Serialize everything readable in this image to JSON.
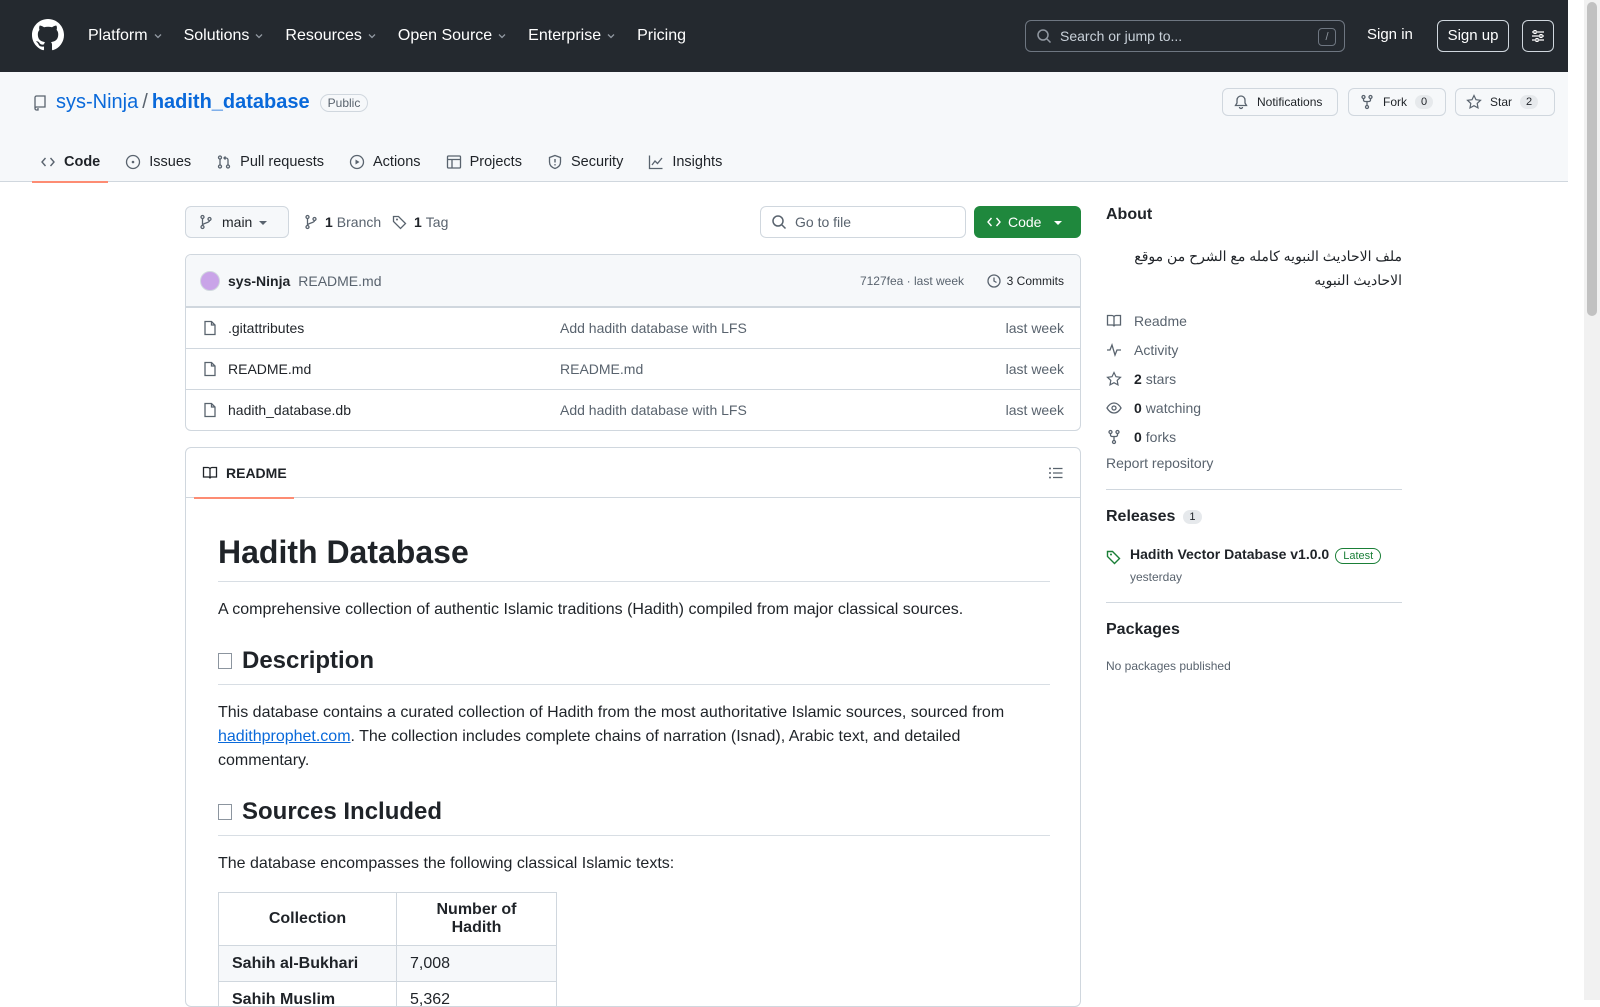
{
  "topnav": {
    "items": [
      "Platform",
      "Solutions",
      "Resources",
      "Open Source",
      "Enterprise",
      "Pricing"
    ],
    "search_placeholder": "Search or jump to...",
    "search_shortcut": "/",
    "sign_in": "Sign in",
    "sign_up": "Sign up"
  },
  "repo": {
    "owner": "sys-Ninja",
    "separator": "/",
    "name": "hadith_database",
    "visibility": "Public",
    "notifications_label": "Notifications",
    "fork_label": "Fork",
    "fork_count": "0",
    "star_label": "Star",
    "star_count": "2"
  },
  "tabs": [
    "Code",
    "Issues",
    "Pull requests",
    "Actions",
    "Projects",
    "Security",
    "Insights"
  ],
  "branch": {
    "name": "main",
    "branch_count": "1",
    "branch_label": "Branch",
    "tag_count": "1",
    "tag_label": "Tag",
    "go_to_file": "Go to file",
    "code_button": "Code"
  },
  "commit": {
    "user": "sys-Ninja",
    "message": "README.md",
    "hash_time": "7127fea · last week",
    "commits": "3 Commits"
  },
  "files": [
    {
      "name": ".gitattributes",
      "message": "Add hadith database with LFS",
      "time": "last week"
    },
    {
      "name": "README.md",
      "message": "README.md",
      "time": "last week"
    },
    {
      "name": "hadith_database.db",
      "message": "Add hadith database with LFS",
      "time": "last week"
    }
  ],
  "readme": {
    "tab_label": "README",
    "title": "Hadith Database",
    "intro": "A comprehensive collection of authentic Islamic traditions (Hadith) compiled from major classical sources.",
    "h_description": "Description",
    "desc_before": "This database contains a curated collection of Hadith from the most authoritative Islamic sources, sourced from ",
    "desc_link": "hadithprophet.com",
    "desc_after": ". The collection includes complete chains of narration (Isnad), Arabic text, and detailed commentary.",
    "h_sources": "Sources Included",
    "sources_intro": "The database encompasses the following classical Islamic texts:",
    "table_headers": [
      "Collection",
      "Number of Hadith"
    ],
    "table_rows": [
      [
        "Sahih al-Bukhari",
        "7,008"
      ],
      [
        "Sahih Muslim",
        "5,362"
      ]
    ]
  },
  "about": {
    "title": "About",
    "description": "ملف الاحاديث النبويه كامله مع الشرح من موقع الاحاديث النبويه",
    "readme": "Readme",
    "activity": "Activity",
    "stars_count": "2",
    "stars_label": "stars",
    "watching_count": "0",
    "watching_label": "watching",
    "forks_count": "0",
    "forks_label": "forks",
    "report": "Report repository"
  },
  "releases": {
    "title": "Releases",
    "count": "1",
    "name": "Hadith Vector Database v1.0.0",
    "badge": "Latest",
    "date": "yesterday"
  },
  "packages": {
    "title": "Packages",
    "empty": "No packages published"
  },
  "colors": {
    "topbar": "#24292f",
    "link": "#0969da",
    "code_button": "#1f883d",
    "active_tab": "#fd8c73"
  }
}
